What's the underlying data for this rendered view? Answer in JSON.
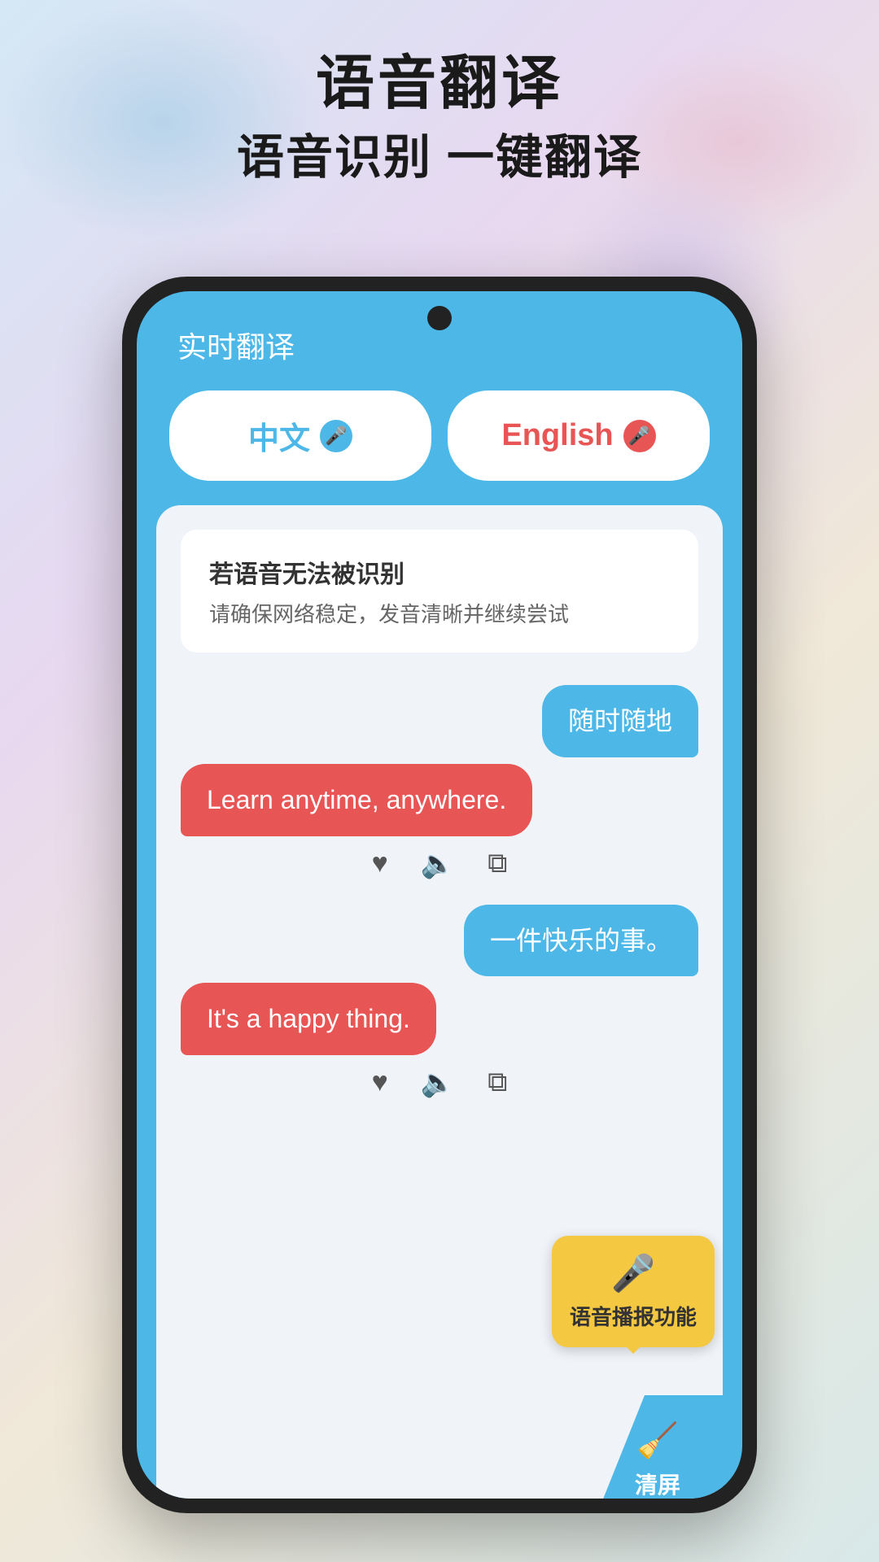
{
  "header": {
    "title_main": "语音翻译",
    "title_sub": "语音识别 一键翻译"
  },
  "phone": {
    "topbar_title": "实时翻译",
    "lang_left": {
      "label": "中文",
      "mic_type": "blue"
    },
    "lang_right": {
      "label": "English",
      "mic_type": "red"
    },
    "info_box": {
      "title": "若语音无法被识别",
      "desc": "请确保网络稳定，发音清晰并继续尝试"
    },
    "messages": [
      {
        "id": 1,
        "right_bubble": "随时随地",
        "left_bubble": "Learn anytime, anywhere."
      },
      {
        "id": 2,
        "right_bubble": "一件快乐的事。",
        "left_bubble": "It's a happy thing."
      }
    ],
    "tooltip": {
      "text": "语音播报功能"
    },
    "clear_button": {
      "label": "清屏"
    }
  },
  "icons": {
    "heart": "♥",
    "volume": "🔊",
    "copy": "❐",
    "mic_unicode": "🎤",
    "broom": "🧹"
  }
}
